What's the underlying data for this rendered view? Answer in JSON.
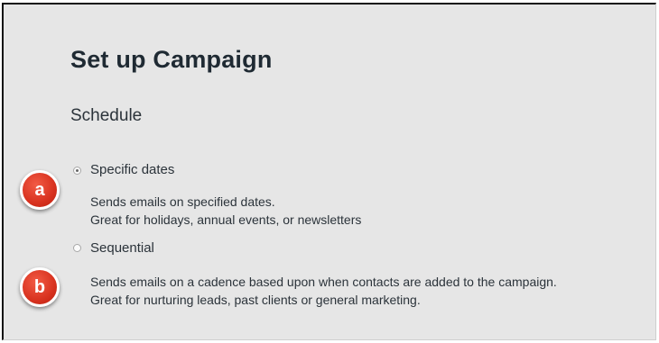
{
  "page": {
    "title": "Set up Campaign",
    "section": "Schedule"
  },
  "options": [
    {
      "label": "Specific dates",
      "selected": true,
      "description_line1": "Sends emails on specified dates.",
      "description_line2": "Great for holidays, annual events, or newsletters"
    },
    {
      "label": "Sequential",
      "selected": false,
      "description_line1": "Sends emails on a cadence based upon when contacts are added to the campaign.",
      "description_line2": "Great for nurturing leads, past clients or general marketing."
    }
  ],
  "annotations": [
    "a",
    "b"
  ],
  "colors": {
    "panel_bg": "#e6e6e6",
    "text": "#2b333a",
    "title": "#1f2a33",
    "marker": "#d8321f"
  }
}
